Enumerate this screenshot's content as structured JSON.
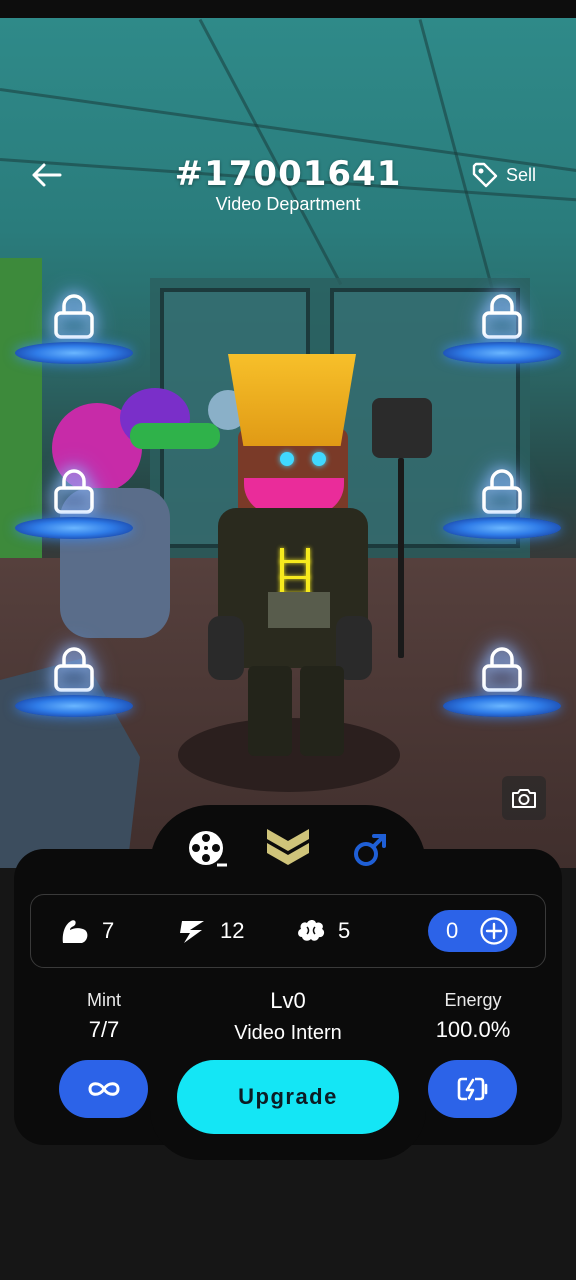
{
  "header": {
    "title": "#17001641",
    "subtitle": "Video Department",
    "sell_label": "Sell"
  },
  "icons": {
    "back": "arrow-left-icon",
    "sell": "price-tag-icon",
    "slot": "lock-icon",
    "camera": "camera-icon",
    "tab_department": "film-reel-icon",
    "tab_rank": "chevron-rank-icon",
    "tab_gender": "male-icon",
    "stat_strength": "flexed-arm-icon",
    "stat_agility": "lightning-icon",
    "stat_intellect": "brain-icon",
    "add_points": "plus-circle-icon",
    "mint": "infinity-icon",
    "energy": "battery-charge-icon"
  },
  "stats": {
    "strength": "7",
    "agility": "12",
    "intellect": "5",
    "unallocated_points": "0"
  },
  "info": {
    "mint_label": "Mint",
    "mint_value": "7/7",
    "level_label": "Lv0",
    "level_title": "Video Intern",
    "energy_label": "Energy",
    "energy_value": "100.0%"
  },
  "actions": {
    "upgrade_label": "Upgrade"
  },
  "colors": {
    "accent_blue": "#2c63e8",
    "upgrade_cyan": "#14e6f5",
    "panel_bg": "#0b0b0b",
    "rank_gold": "#cfc47a",
    "male_blue": "#1f5fd6"
  }
}
